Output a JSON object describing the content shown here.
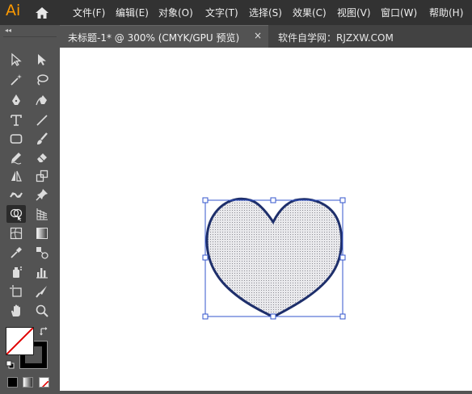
{
  "app": {
    "logo": "Ai"
  },
  "menu": {
    "items": [
      "文件(F)",
      "编辑(E)",
      "对象(O)",
      "文字(T)",
      "选择(S)",
      "效果(C)",
      "视图(V)",
      "窗口(W)",
      "帮助(H)"
    ]
  },
  "document_tab": {
    "title": "未标题-1* @ 300% (CMYK/GPU 预览)",
    "close": "×"
  },
  "secondary_tab": {
    "title": "软件自学网：RJZXW.COM"
  },
  "toolbar": {
    "collapse_glyph": "◂◂",
    "active_tool": "shape-builder-tool"
  },
  "colors": {
    "accent": "#FF9A00",
    "selection": "#3355CC",
    "heart_stroke": "#1E2F6B",
    "none_slash": "#E00000"
  }
}
